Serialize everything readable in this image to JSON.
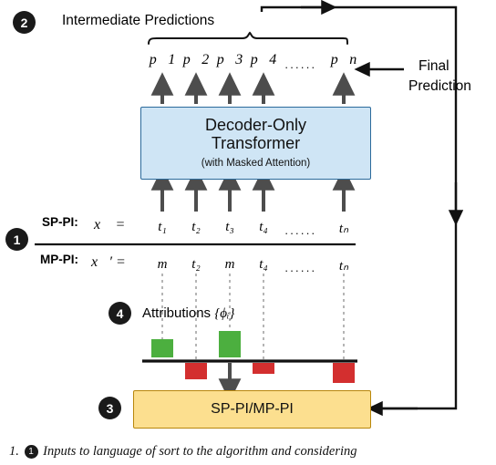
{
  "diagram": {
    "badges": [
      {
        "id": "badge-1",
        "label": "1"
      },
      {
        "id": "badge-2",
        "label": "2"
      },
      {
        "id": "badge-3",
        "label": "3"
      },
      {
        "id": "badge-4",
        "label": "4"
      }
    ],
    "headings": {
      "intermediate_predictions": "Intermediate Predictions",
      "final_prediction_line1": "Final",
      "final_prediction_line2": "Prediction",
      "attributions": "Attributions"
    },
    "attributions_math": "{ϕᵢ}",
    "transformer_box": {
      "line1": "Decoder-Only",
      "line2": "Transformer",
      "line3": "(with Masked Attention)",
      "fill": "#cfe5f5",
      "stroke": "#2b6a9b"
    },
    "attribution_box": {
      "label": "SP-PI/MP-PI",
      "fill": "#fcdf8f",
      "stroke": "#b8860b"
    },
    "predictions": {
      "items": [
        "p⃗1",
        "p⃗2",
        "p⃗3",
        "p⃗4",
        "p⃗n"
      ],
      "ellipsis": "······"
    },
    "rows": [
      {
        "name": "sp-pi",
        "label": "SP-PI:",
        "vector": "x⃗ =",
        "tokens": [
          "t₁",
          "t₂",
          "t₃",
          "t₄",
          "tₙ"
        ],
        "ellipsis": "······"
      },
      {
        "name": "mp-pi",
        "label": "MP-PI:",
        "vector": "x⃗′ =",
        "tokens": [
          "m",
          "t₂",
          "m",
          "t₄",
          "tₙ"
        ],
        "ellipsis": "······"
      }
    ],
    "attribution_chart": {
      "type": "bar",
      "baseline_y": 0,
      "positive_color": "#4caf3f",
      "negative_color": "#d32f2f",
      "bars": [
        {
          "token": "t₁",
          "value": 0.55,
          "color": "#4caf3f"
        },
        {
          "token": "t₂",
          "value": -0.7,
          "color": "#d32f2f"
        },
        {
          "token": "t₃",
          "value": 0.95,
          "color": "#4caf3f"
        },
        {
          "token": "t₄",
          "value": -0.35,
          "color": "#d32f2f"
        },
        {
          "token": "tₙ",
          "value": -0.8,
          "color": "#d32f2f"
        }
      ]
    },
    "caption": {
      "prefix": "1.",
      "badge": "1",
      "text": "Inputs to language of sort to the algorithm and considering"
    },
    "colors": {
      "arrow": "#4d4d4d",
      "line": "#111111",
      "badge_bg": "#1a1a1a",
      "dotted": "#b0b0b0"
    }
  }
}
